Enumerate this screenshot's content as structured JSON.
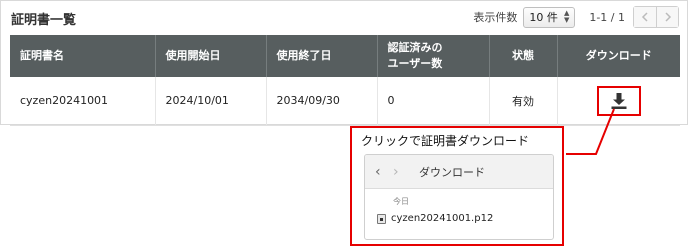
{
  "panel": {
    "title": "証明書一覧",
    "pagination": {
      "per_page_label": "表示件数",
      "per_page_value": "10 件",
      "range": "1-1 / 1"
    }
  },
  "table": {
    "headers": {
      "name": "証明書名",
      "start": "使用開始日",
      "end": "使用終了日",
      "auth_line1": "認証済みの",
      "auth_line2": "ユーザー数",
      "status": "状態",
      "download": "ダウンロード"
    },
    "rows": [
      {
        "name": "cyzen20241001",
        "start": "2024/10/01",
        "end": "2034/09/30",
        "auth_users": "0",
        "status": "有効"
      }
    ]
  },
  "callout": {
    "title": "クリックで証明書ダウンロード",
    "browser": {
      "title": "ダウンロード",
      "section": "今日",
      "file_name": "cyzen20241001.p12"
    }
  },
  "colors": {
    "header_bg": "#575e5f",
    "status_active": "#5bb35b",
    "highlight": "#e60000"
  }
}
